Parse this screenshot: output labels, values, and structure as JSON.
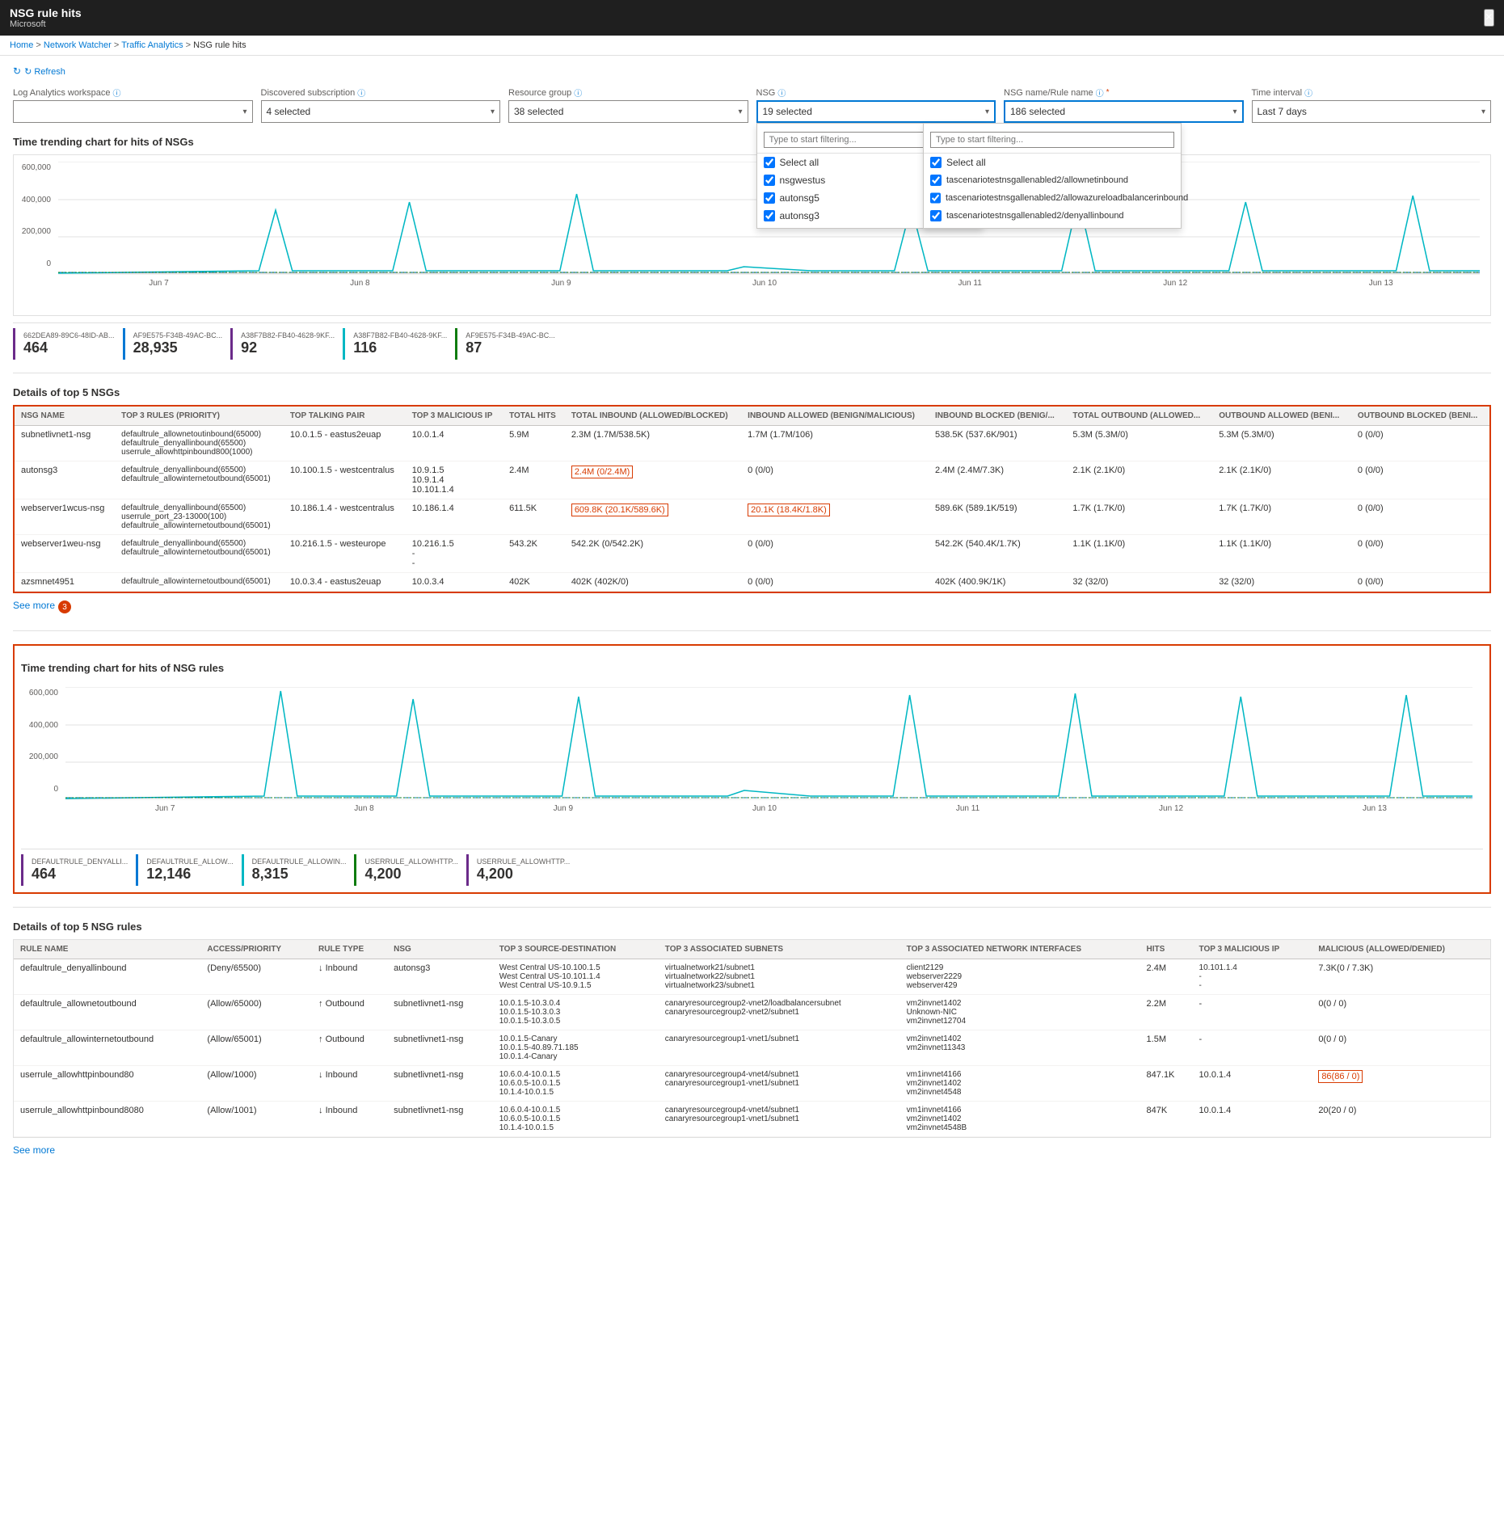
{
  "titleBar": {
    "appTitle": "NSG rule hits",
    "company": "Microsoft",
    "closeLabel": "×"
  },
  "breadcrumb": {
    "home": "Home",
    "networkWatcher": "Network Watcher",
    "trafficAnalytics": "Traffic Analytics",
    "current": "NSG rule hits"
  },
  "refreshBtn": "↻ Refresh",
  "filters": {
    "logAnalytics": {
      "label": "Log Analytics workspace",
      "value": ""
    },
    "discoveredSubscription": {
      "label": "Discovered subscription",
      "value": "4 selected"
    },
    "resourceGroup": {
      "label": "Resource group",
      "value": "38 selected"
    },
    "nsg": {
      "label": "NSG",
      "value": "19 selected",
      "placeholder": "Type to start filtering...",
      "items": [
        {
          "label": "Select all",
          "checked": true
        },
        {
          "label": "nsgwestus",
          "checked": true
        },
        {
          "label": "autonsg5",
          "checked": true
        },
        {
          "label": "autonsg3",
          "checked": true
        }
      ]
    },
    "nsgRuleName": {
      "label": "NSG name/Rule name",
      "value": "186 selected",
      "placeholder": "Type to start filtering...",
      "selectAllLabel": "Select all",
      "items": [
        {
          "label": "tascenariotestnsgallenabled2/allownetinbound",
          "checked": true
        },
        {
          "label": "tascenariotestnsgallenabled2/allowazureloadbalancerinbound",
          "checked": true
        },
        {
          "label": "tascenariotestnsgallenabled2/denyallinbound",
          "checked": true
        }
      ]
    },
    "timeInterval": {
      "label": "Time interval",
      "value": "Last 7 days"
    }
  },
  "nsgChart": {
    "title": "Time trending chart for hits of NSGs",
    "yLabels": [
      "600,000",
      "400,000",
      "200,000",
      "0"
    ],
    "xLabels": [
      "Jun 7",
      "Jun 8",
      "Jun 9",
      "Jun 10",
      "Jun 11",
      "Jun 12",
      "Jun 13"
    ],
    "stats": [
      {
        "label": "662DEA89-89C6-48ID-AB...",
        "value": "464",
        "color": "#6b2b8a"
      },
      {
        "label": "AF9E575-F34B-49AC-BC...",
        "value": "28,935",
        "color": "#0078d4"
      },
      {
        "label": "A38F7B82-FB40-4628-9KF...",
        "value": "92",
        "color": "#6b2b8a"
      },
      {
        "label": "A38F7B82-FB40-4628-9KF...",
        "value": "116",
        "color": "#00b7c3"
      },
      {
        "label": "AF9E575-F34B-49AC-BC...",
        "value": "87",
        "color": "#107c10"
      }
    ]
  },
  "nsgDetailsTable": {
    "title": "Details of top 5 NSGs",
    "columns": [
      "NSG NAME",
      "TOP 3 RULES (PRIORITY)",
      "TOP TALKING PAIR",
      "TOP 3 MALICIOUS IP",
      "TOTAL HITS",
      "TOTAL INBOUND (ALLOWED/BLOCKED)",
      "INBOUND ALLOWED (BENIGN/MALICIOUS)",
      "INBOUND BLOCKED (BENIG/...",
      "TOTAL OUTBOUND (ALLOWED...",
      "OUTBOUND ALLOWED (BENI...",
      "OUTBOUND BLOCKED (BENI..."
    ],
    "rows": [
      {
        "nsgName": "subnetlivnet1-nsg",
        "rules": "defaultrule_allownetoutinbound(65000)\ndefaultrule_denyallinbound(65500)\nuserrule_allowhttpinbound800(1000)",
        "talkingPair": "10.0.1.5 - eastus2euap",
        "maliciousIp": "10.0.1.4",
        "totalHits": "5.9M",
        "totalInbound": "2.3M (1.7M/538.5K)",
        "inboundAllowed": "1.7M (1.7M/106)",
        "inboundBlocked": "538.5K (537.6K/901)",
        "totalOutbound": "5.3M (5.3M/0)",
        "outboundAllowed": "5.3M (5.3M/0)",
        "outboundBlocked": "0 (0/0)"
      },
      {
        "nsgName": "autonsg3",
        "rules": "defaultrule_denyallinbound(65500)\ndefaultrule_allowinternetoutbound(65001)",
        "talkingPair": "10.100.1.5 - westcentralus",
        "maliciousIp": "10.9.1.5\n10.9.1.4\n10.101.1.4",
        "totalHits": "2.4M",
        "totalInbound": "2.4M (0/2.4M)",
        "inboundAllowed": "0 (0/0)",
        "inboundBlocked": "2.4M (2.4M/7.3K)",
        "totalOutbound": "2.1K (2.1K/0)",
        "outboundAllowed": "2.1K (2.1K/0)",
        "outboundBlocked": "0 (0/0)",
        "highlight": "totalInbound"
      },
      {
        "nsgName": "webserver1wcus-nsg",
        "rules": "defaultrule_denyallinbound(65500)\nuserrule_port_23-13000(100)\ndefaultrule_allowinternetoutbound(65001)",
        "talkingPair": "10.186.1.4 - westcentralus",
        "maliciousIp": "10.186.1.4",
        "totalHits": "611.5K",
        "totalInbound": "609.8K (20.1K/589.6K)",
        "inboundAllowed": "20.1K (18.4K/1.8K)",
        "inboundBlocked": "589.6K (589.1K/519)",
        "totalOutbound": "1.7K (1.7K/0)",
        "outboundAllowed": "1.7K (1.7K/0)",
        "outboundBlocked": "0 (0/0)",
        "highlight": "totalInbound,inboundAllowed"
      },
      {
        "nsgName": "webserver1weu-nsg",
        "rules": "defaultrule_denyallinbound(65500)\ndefaultrule_allowinternetoutbound(65001)",
        "talkingPair": "10.216.1.5 - westeurope",
        "maliciousIp": "10.216.1.5\n-\n-",
        "totalHits": "543.2K",
        "totalInbound": "542.2K (0/542.2K)",
        "inboundAllowed": "0 (0/0)",
        "inboundBlocked": "542.2K (540.4K/1.7K)",
        "totalOutbound": "1.1K (1.1K/0)",
        "outboundAllowed": "1.1K (1.1K/0)",
        "outboundBlocked": "0 (0/0)"
      },
      {
        "nsgName": "azsmnet4951",
        "rules": "defaultrule_allowinternetoutbound(65001)",
        "talkingPair": "10.0.3.4 - eastus2euap",
        "maliciousIp": "10.0.3.4",
        "totalHits": "402K",
        "totalInbound": "402K (402K/0)",
        "inboundAllowed": "0 (0/0)",
        "inboundBlocked": "402K (400.9K/1K)",
        "totalOutbound": "32 (32/0)",
        "outboundAllowed": "32 (32/0)",
        "outboundBlocked": "0 (0/0)"
      }
    ],
    "seeMore": "See more",
    "badge": "3"
  },
  "nsgRulesChart": {
    "title": "Time trending chart for hits of NSG rules",
    "yLabels": [
      "600,000",
      "400,000",
      "200,000",
      "0"
    ],
    "xLabels": [
      "Jun 7",
      "Jun 8",
      "Jun 9",
      "Jun 10",
      "Jun 11",
      "Jun 12",
      "Jun 13"
    ],
    "stats": [
      {
        "label": "DEFAULTRULE_DENYALLI...",
        "value": "464",
        "color": "#6b2b8a"
      },
      {
        "label": "DEFAULTRULE_ALLOW...",
        "value": "12,146",
        "color": "#0078d4"
      },
      {
        "label": "DEFAULTRULE_ALLOWIN...",
        "value": "8,315",
        "color": "#00b7c3"
      },
      {
        "label": "USERRULE_ALLOWHTTP...",
        "value": "4,200",
        "color": "#107c10"
      },
      {
        "label": "USERRULE_ALLOWHTTP...",
        "value": "4,200",
        "color": "#6b2b8a"
      }
    ]
  },
  "nsgRulesTable": {
    "title": "Details of top 5 NSG rules",
    "columns": [
      "RULE NAME",
      "ACCESS/PRIORITY",
      "RULE TYPE",
      "NSG",
      "TOP 3 SOURCE-DESTINATION",
      "TOP 3 ASSOCIATED SUBNETS",
      "TOP 3 ASSOCIATED NETWORK INTERFACES",
      "HITS",
      "TOP 3 MALICIOUS IP",
      "MALICIOUS (ALLOWED/DENIED)"
    ],
    "rows": [
      {
        "ruleName": "defaultrule_denyallinbound",
        "access": "(Deny/65500)",
        "ruleType": "↓ Inbound",
        "nsg": "autonsg3",
        "sourceDestination": "West Central US-10.100.1.5\nWest Central US-10.101.1.4\nWest Central US-10.9.1.5",
        "subnets": "virtualnetwork21/subnet1\nvirtualnetwork22/subnet1\nvirtualnetwork23/subnet1",
        "networkInterfaces": "client2129\nwebserver2229\nwebserver429",
        "hits": "2.4M",
        "maliciousIp": "10.101.1.4\n-\n-",
        "malicious": "7.3K(0 / 7.3K)"
      },
      {
        "ruleName": "defaultrule_allownetoutbound",
        "access": "(Allow/65000)",
        "ruleType": "↑ Outbound",
        "nsg": "subnetlivnet1-nsg",
        "sourceDestination": "10.0.1.5-10.3.0.4\n10.0.1.5-10.3.0.3\n10.0.1.5-10.3.0.5",
        "subnets": "canaryresourcegroup2-vnet2/loadbalancersubnet\ncanaryresourcegroup2-vnet2/subnet1",
        "networkInterfaces": "vm2invnet1402\nUnknown-NIC\nvm2invnet12704",
        "hits": "2.2M",
        "maliciousIp": "-",
        "malicious": "0(0 / 0)"
      },
      {
        "ruleName": "defaultrule_allowinternetoutbound",
        "access": "(Allow/65001)",
        "ruleType": "↑ Outbound",
        "nsg": "subnetlivnet1-nsg",
        "sourceDestination": "10.0.1.5-Canary\n10.0.1.5-40.89.71.185\n10.0.1.4-Canary",
        "subnets": "canaryresourcegroup1-vnet1/subnet1",
        "networkInterfaces": "vm2invnet1402\nvm2invnet11343",
        "hits": "1.5M",
        "maliciousIp": "-",
        "malicious": "0(0 / 0)"
      },
      {
        "ruleName": "userrule_allowhttpinbound80",
        "access": "(Allow/1000)",
        "ruleType": "↓ Inbound",
        "nsg": "subnetlivnet1-nsg",
        "sourceDestination": "10.6.0.4-10.0.1.5\n10.6.0.5-10.0.1.5\n10.1.4-10.0.1.5",
        "subnets": "canaryresourcegroup4-vnet4/subnet1\ncanaryresourcegroup1-vnet1/subnet1",
        "networkInterfaces": "vm1invnet4166\nvm2invnet1402\nvm2invnet4548",
        "hits": "847.1K",
        "maliciousIp": "10.0.1.4",
        "malicious": "86(86 / 0)",
        "highlightMalicious": true
      },
      {
        "ruleName": "userrule_allowhttpinbound8080",
        "access": "(Allow/1001)",
        "ruleType": "↓ Inbound",
        "nsg": "subnetlivnet1-nsg",
        "sourceDestination": "10.6.0.4-10.0.1.5\n10.6.0.5-10.0.1.5\n10.1.4-10.0.1.5",
        "subnets": "canaryresourcegroup4-vnet4/subnet1\ncanaryresourcegroup1-vnet1/subnet1",
        "networkInterfaces": "vm1invnet4166\nvm2invnet1402\nvm2invnet4548B",
        "hits": "847K",
        "maliciousIp": "10.0.1.4",
        "malicious": "20(20 / 0)"
      }
    ],
    "seeMore": "See more"
  }
}
